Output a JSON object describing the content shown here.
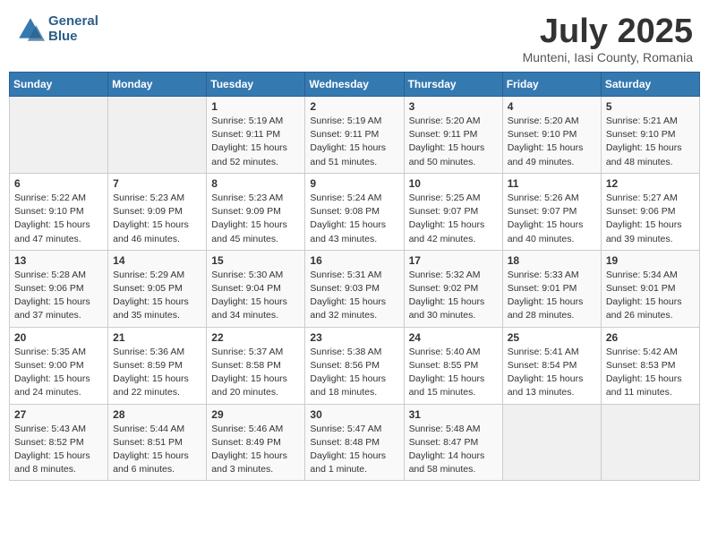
{
  "header": {
    "logo_line1": "General",
    "logo_line2": "Blue",
    "month": "July 2025",
    "location": "Munteni, Iasi County, Romania"
  },
  "weekdays": [
    "Sunday",
    "Monday",
    "Tuesday",
    "Wednesday",
    "Thursday",
    "Friday",
    "Saturday"
  ],
  "weeks": [
    [
      {
        "day": "",
        "info": ""
      },
      {
        "day": "",
        "info": ""
      },
      {
        "day": "1",
        "info": "Sunrise: 5:19 AM\nSunset: 9:11 PM\nDaylight: 15 hours\nand 52 minutes."
      },
      {
        "day": "2",
        "info": "Sunrise: 5:19 AM\nSunset: 9:11 PM\nDaylight: 15 hours\nand 51 minutes."
      },
      {
        "day": "3",
        "info": "Sunrise: 5:20 AM\nSunset: 9:11 PM\nDaylight: 15 hours\nand 50 minutes."
      },
      {
        "day": "4",
        "info": "Sunrise: 5:20 AM\nSunset: 9:10 PM\nDaylight: 15 hours\nand 49 minutes."
      },
      {
        "day": "5",
        "info": "Sunrise: 5:21 AM\nSunset: 9:10 PM\nDaylight: 15 hours\nand 48 minutes."
      }
    ],
    [
      {
        "day": "6",
        "info": "Sunrise: 5:22 AM\nSunset: 9:10 PM\nDaylight: 15 hours\nand 47 minutes."
      },
      {
        "day": "7",
        "info": "Sunrise: 5:23 AM\nSunset: 9:09 PM\nDaylight: 15 hours\nand 46 minutes."
      },
      {
        "day": "8",
        "info": "Sunrise: 5:23 AM\nSunset: 9:09 PM\nDaylight: 15 hours\nand 45 minutes."
      },
      {
        "day": "9",
        "info": "Sunrise: 5:24 AM\nSunset: 9:08 PM\nDaylight: 15 hours\nand 43 minutes."
      },
      {
        "day": "10",
        "info": "Sunrise: 5:25 AM\nSunset: 9:07 PM\nDaylight: 15 hours\nand 42 minutes."
      },
      {
        "day": "11",
        "info": "Sunrise: 5:26 AM\nSunset: 9:07 PM\nDaylight: 15 hours\nand 40 minutes."
      },
      {
        "day": "12",
        "info": "Sunrise: 5:27 AM\nSunset: 9:06 PM\nDaylight: 15 hours\nand 39 minutes."
      }
    ],
    [
      {
        "day": "13",
        "info": "Sunrise: 5:28 AM\nSunset: 9:06 PM\nDaylight: 15 hours\nand 37 minutes."
      },
      {
        "day": "14",
        "info": "Sunrise: 5:29 AM\nSunset: 9:05 PM\nDaylight: 15 hours\nand 35 minutes."
      },
      {
        "day": "15",
        "info": "Sunrise: 5:30 AM\nSunset: 9:04 PM\nDaylight: 15 hours\nand 34 minutes."
      },
      {
        "day": "16",
        "info": "Sunrise: 5:31 AM\nSunset: 9:03 PM\nDaylight: 15 hours\nand 32 minutes."
      },
      {
        "day": "17",
        "info": "Sunrise: 5:32 AM\nSunset: 9:02 PM\nDaylight: 15 hours\nand 30 minutes."
      },
      {
        "day": "18",
        "info": "Sunrise: 5:33 AM\nSunset: 9:01 PM\nDaylight: 15 hours\nand 28 minutes."
      },
      {
        "day": "19",
        "info": "Sunrise: 5:34 AM\nSunset: 9:01 PM\nDaylight: 15 hours\nand 26 minutes."
      }
    ],
    [
      {
        "day": "20",
        "info": "Sunrise: 5:35 AM\nSunset: 9:00 PM\nDaylight: 15 hours\nand 24 minutes."
      },
      {
        "day": "21",
        "info": "Sunrise: 5:36 AM\nSunset: 8:59 PM\nDaylight: 15 hours\nand 22 minutes."
      },
      {
        "day": "22",
        "info": "Sunrise: 5:37 AM\nSunset: 8:58 PM\nDaylight: 15 hours\nand 20 minutes."
      },
      {
        "day": "23",
        "info": "Sunrise: 5:38 AM\nSunset: 8:56 PM\nDaylight: 15 hours\nand 18 minutes."
      },
      {
        "day": "24",
        "info": "Sunrise: 5:40 AM\nSunset: 8:55 PM\nDaylight: 15 hours\nand 15 minutes."
      },
      {
        "day": "25",
        "info": "Sunrise: 5:41 AM\nSunset: 8:54 PM\nDaylight: 15 hours\nand 13 minutes."
      },
      {
        "day": "26",
        "info": "Sunrise: 5:42 AM\nSunset: 8:53 PM\nDaylight: 15 hours\nand 11 minutes."
      }
    ],
    [
      {
        "day": "27",
        "info": "Sunrise: 5:43 AM\nSunset: 8:52 PM\nDaylight: 15 hours\nand 8 minutes."
      },
      {
        "day": "28",
        "info": "Sunrise: 5:44 AM\nSunset: 8:51 PM\nDaylight: 15 hours\nand 6 minutes."
      },
      {
        "day": "29",
        "info": "Sunrise: 5:46 AM\nSunset: 8:49 PM\nDaylight: 15 hours\nand 3 minutes."
      },
      {
        "day": "30",
        "info": "Sunrise: 5:47 AM\nSunset: 8:48 PM\nDaylight: 15 hours\nand 1 minute."
      },
      {
        "day": "31",
        "info": "Sunrise: 5:48 AM\nSunset: 8:47 PM\nDaylight: 14 hours\nand 58 minutes."
      },
      {
        "day": "",
        "info": ""
      },
      {
        "day": "",
        "info": ""
      }
    ]
  ]
}
